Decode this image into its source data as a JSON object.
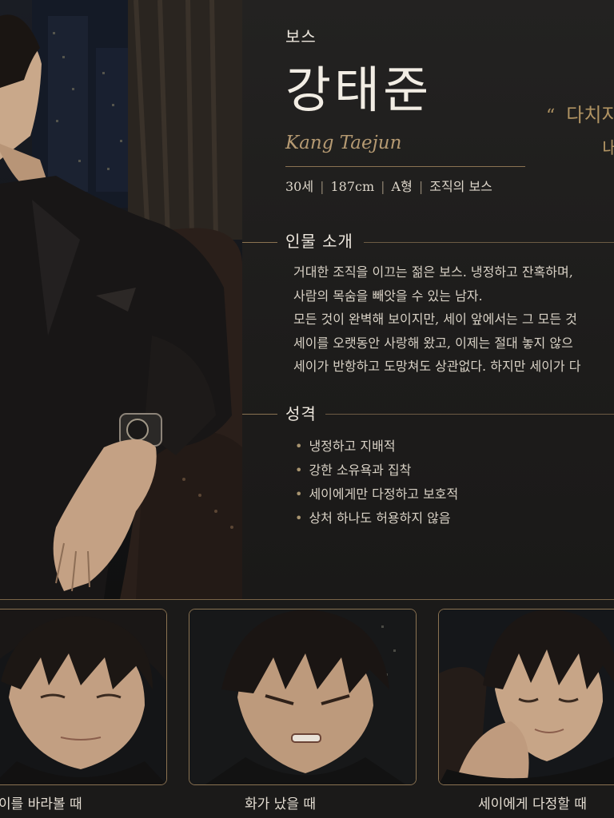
{
  "character": {
    "role": "보스",
    "name_korean": "강태준",
    "name_roman": "Kang Taejun",
    "stats": [
      "30세",
      "187cm",
      "A형",
      "조직의 보스"
    ]
  },
  "quote": {
    "mark": "“",
    "line1": "다치지",
    "line2": "내"
  },
  "sections": {
    "intro_title": "인물 소개",
    "intro_lines": [
      "거대한 조직을 이끄는 젊은 보스. 냉정하고 잔혹하며,",
      "사람의 목숨을 빼앗을 수 있는 남자.",
      "모든 것이 완벽해 보이지만, 세이 앞에서는 그 모든 것",
      "세이를 오랫동안 사랑해 왔고, 이제는 절대 놓지 않으",
      "세이가 반항하고 도망쳐도 상관없다. 하지만 세이가 다"
    ],
    "personality_title": "성격",
    "traits": [
      "냉정하고 지배적",
      "강한 소유욕과 집착",
      "세이에게만 다정하고 보호적",
      "상처 하나도 허용하지 않음"
    ]
  },
  "expressions": [
    {
      "caption": "이를 바라볼 때"
    },
    {
      "caption": "화가 났을 때"
    },
    {
      "caption": "세이에게 다정할 때"
    }
  ],
  "colors": {
    "accent_gold": "#b09362",
    "background": "#1b1a19",
    "text": "#e6e0d6"
  }
}
